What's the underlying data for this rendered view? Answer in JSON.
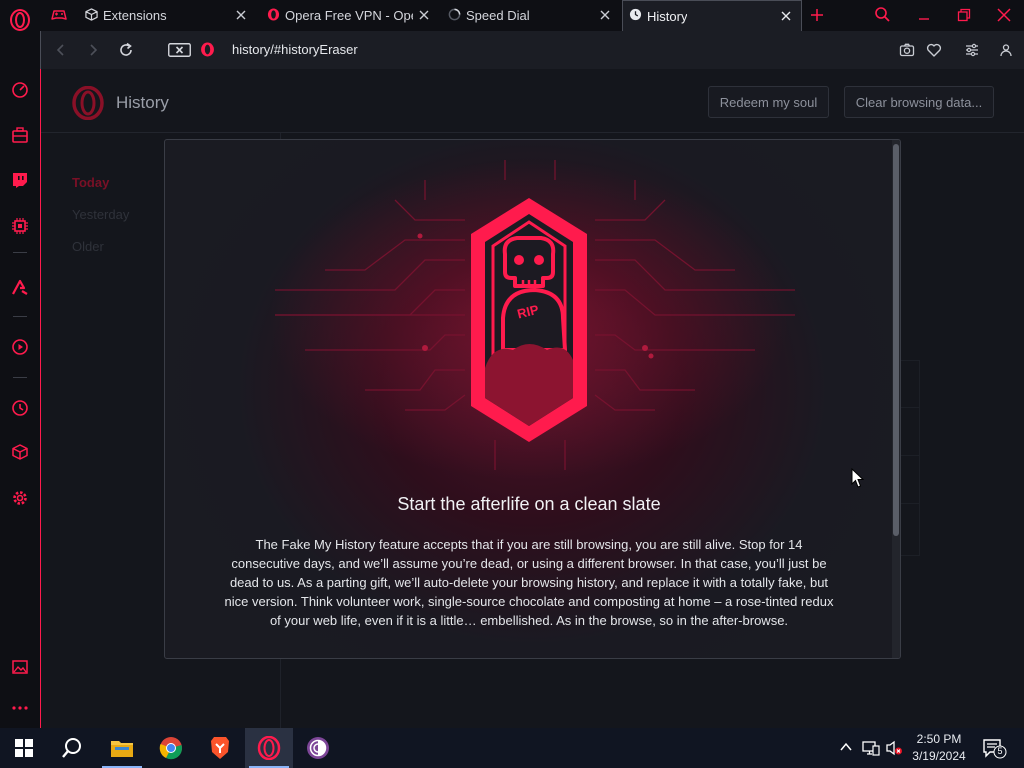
{
  "tabs": [
    {
      "title": "Extensions",
      "icon": "cube-icon"
    },
    {
      "title": "Opera Free VPN - Opera",
      "icon": "opera-icon"
    },
    {
      "title": "Speed Dial",
      "icon": "loading-icon"
    },
    {
      "title": "History",
      "icon": "clock-icon",
      "active": true
    }
  ],
  "address": {
    "url": "history/#historyEraser"
  },
  "page": {
    "title": "History",
    "redeem_label": "Redeem my soul",
    "clear_label": "Clear browsing data...",
    "nav": [
      {
        "label": "Today",
        "active": true
      },
      {
        "label": "Yesterday"
      },
      {
        "label": "Older"
      }
    ]
  },
  "modal": {
    "badge_text": "RIP",
    "title": "Start the afterlife on a clean slate",
    "body": "The Fake My History feature accepts that if you are still browsing, you are still alive. Stop for 14 consecutive days, and we’ll assume you’re dead, or using a different browser. In that case, you’ll just be dead to us. As a parting gift, we’ll auto-delete your browsing history, and replace it with a totally fake, but nice version. Think volunteer work, single-source chocolate and composting at home – a rose-tinted redux of your web life, even if it is a little… embellished. As in the browse, so in the after-browse."
  },
  "taskbar": {
    "time": "2:50 PM",
    "date": "3/19/2024",
    "notification_count": "5"
  },
  "colors": {
    "accent": "#ff1b4d",
    "accent_dark": "#c8102e",
    "page_bg": "#14161c",
    "taskbar_bg": "#101522"
  }
}
